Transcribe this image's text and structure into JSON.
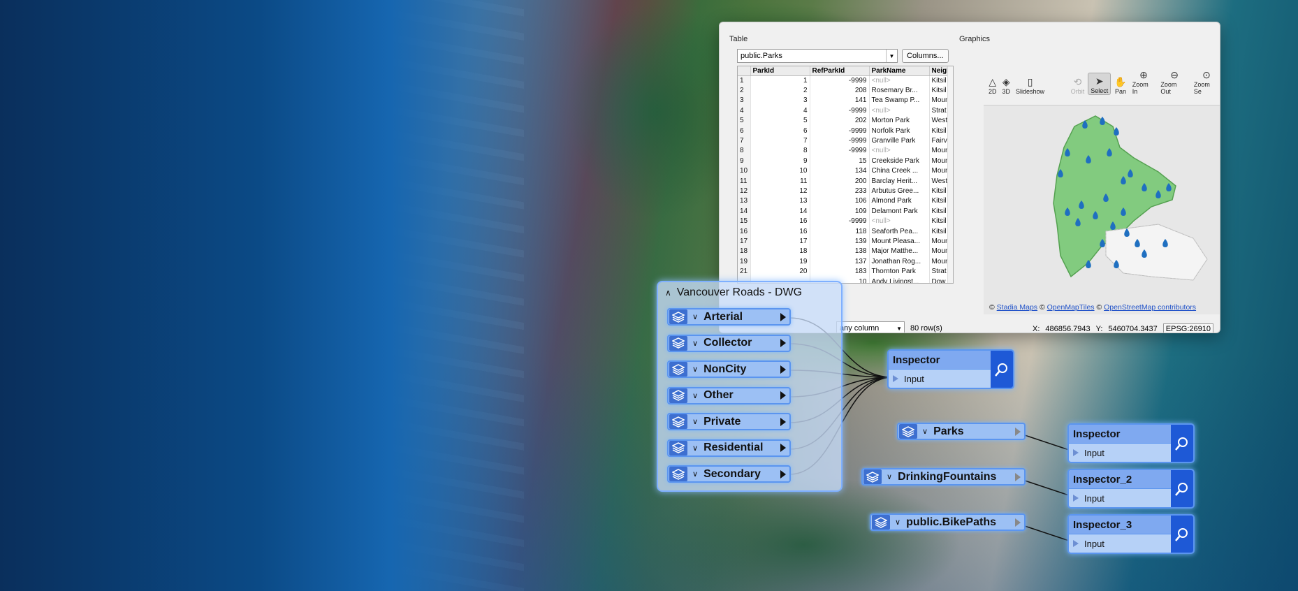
{
  "table_pane": {
    "title": "Table",
    "source": "public.Parks",
    "columns_button": "Columns...",
    "headers": [
      "",
      "ParkId",
      "RefParkId",
      "ParkName",
      "Neigh"
    ],
    "rows": [
      [
        "1",
        "1",
        "-9999",
        "<null>",
        "Kitsil"
      ],
      [
        "2",
        "2",
        "208",
        "Rosemary Br...",
        "Kitsil"
      ],
      [
        "3",
        "3",
        "141",
        "Tea Swamp P...",
        "Moun"
      ],
      [
        "4",
        "4",
        "-9999",
        "<null>",
        "Strat"
      ],
      [
        "5",
        "5",
        "202",
        "Morton Park",
        "West"
      ],
      [
        "6",
        "6",
        "-9999",
        "Norfolk Park",
        "Kitsil"
      ],
      [
        "7",
        "7",
        "-9999",
        "Granville Park",
        "Fairvi"
      ],
      [
        "8",
        "8",
        "-9999",
        "<null>",
        "Moun"
      ],
      [
        "9",
        "9",
        "15",
        "Creekside Park",
        "Moun"
      ],
      [
        "10",
        "10",
        "134",
        "China Creek ...",
        "Moun"
      ],
      [
        "11",
        "11",
        "200",
        "Barclay Herit...",
        "West"
      ],
      [
        "12",
        "12",
        "233",
        "Arbutus Gree...",
        "Kitsil"
      ],
      [
        "13",
        "13",
        "106",
        "Almond Park",
        "Kitsil"
      ],
      [
        "14",
        "14",
        "109",
        "Delamont Park",
        "Kitsil"
      ],
      [
        "15",
        "16",
        "-9999",
        "<null>",
        "Kitsil"
      ],
      [
        "16",
        "16",
        "118",
        "Seaforth Pea...",
        "Kitsil"
      ],
      [
        "17",
        "17",
        "139",
        "Mount Pleasa...",
        "Moun"
      ],
      [
        "18",
        "18",
        "138",
        "Major Matthe...",
        "Moun"
      ],
      [
        "19",
        "19",
        "137",
        "Jonathan Rog...",
        "Moun"
      ],
      [
        "21",
        "20",
        "183",
        "Thornton Park",
        "Strat"
      ],
      [
        "",
        "",
        "10",
        "Andy Livingst...",
        "Dow"
      ]
    ],
    "filter_value": "any column",
    "row_count": "80 row(s)"
  },
  "graphics_pane": {
    "title": "Graphics",
    "tools": [
      {
        "label": "2D",
        "icon": "triangle-2d-icon",
        "glyph": "△"
      },
      {
        "label": "3D",
        "icon": "cube-3d-icon",
        "glyph": "◈"
      },
      {
        "label": "Slideshow",
        "icon": "slideshow-icon",
        "glyph": "▯"
      },
      {
        "label": "Orbit",
        "icon": "orbit-icon",
        "glyph": "⟲"
      },
      {
        "label": "Select",
        "icon": "cursor-icon",
        "glyph": "➤"
      },
      {
        "label": "Pan",
        "icon": "hand-icon",
        "glyph": "✋"
      },
      {
        "label": "Zoom In",
        "icon": "zoom-in-icon",
        "glyph": "⊕"
      },
      {
        "label": "Zoom Out",
        "icon": "zoom-out-icon",
        "glyph": "⊖"
      },
      {
        "label": "Zoom Se",
        "icon": "zoom-selection-icon",
        "glyph": "⊙"
      }
    ],
    "attribution": {
      "sep1": "©",
      "link1": "Stadia Maps",
      "sep2": "©",
      "link2": "OpenMapTiles",
      "sep3": "©",
      "link3": "OpenStreetMap contributors"
    },
    "x_label": "X:",
    "x_value": "486856.7943",
    "y_label": "Y:",
    "y_value": "5460704.3437",
    "epsg": "EPSG:26910"
  },
  "bookmark": {
    "title": "Vancouver Roads - DWG",
    "layers": [
      "Arterial",
      "Collector",
      "NonCity",
      "Other",
      "Private",
      "Residential",
      "Secondary"
    ]
  },
  "readers": [
    "Parks",
    "DrinkingFountains",
    "public.BikePaths"
  ],
  "inspectors": [
    {
      "name": "Inspector",
      "port": "Input"
    },
    {
      "name": "Inspector",
      "port": "Input"
    },
    {
      "name": "Inspector_2",
      "port": "Input"
    },
    {
      "name": "Inspector_3",
      "port": "Input"
    }
  ],
  "colors": {
    "accent": "#1e59d6",
    "node_fill": "#9cc0f4",
    "node_border": "#5b95ef",
    "link": "#1e50c8"
  }
}
